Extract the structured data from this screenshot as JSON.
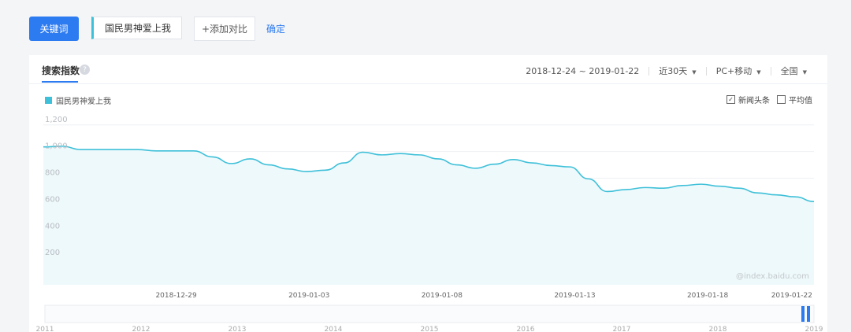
{
  "toolbar": {
    "keyword_btn": "关键词",
    "keyword_value": "国民男神爱上我",
    "add_compare": "+添加对比",
    "confirm": "确定"
  },
  "panel": {
    "tab": "搜索指数",
    "help_icon": "?",
    "date_range": "2018-12-24 ~ 2019-01-22",
    "period": "近30天",
    "device": "PC+移动",
    "region": "全国"
  },
  "options": {
    "news_label": "新闻头条",
    "news_checked": true,
    "avg_label": "平均值",
    "avg_checked": false
  },
  "watermark": "@index.baidu.com",
  "colors": {
    "accent": "#2d7bf0",
    "series": "#3ec0d8"
  },
  "chart_data": {
    "type": "area",
    "series": [
      {
        "name": "国民男神爱上我",
        "values": [
          1035,
          1040,
          1015,
          1015,
          1015,
          1015,
          1005,
          1005,
          1005,
          960,
          910,
          945,
          900,
          870,
          850,
          860,
          915,
          995,
          975,
          985,
          975,
          945,
          900,
          875,
          905,
          940,
          915,
          895,
          885,
          795,
          700,
          715,
          730,
          725,
          745,
          755,
          740,
          725,
          690,
          675,
          660,
          625
        ]
      }
    ],
    "x_ticks": [
      "2018-12-29",
      "2019-01-03",
      "2019-01-08",
      "2019-01-13",
      "2019-01-18",
      "2019-01-22"
    ],
    "y_ticks": [
      "1,200",
      "1,000",
      "800",
      "600",
      "400",
      "200"
    ],
    "ylim": [
      0,
      1240
    ],
    "grid": true,
    "legend": "top-left",
    "overview_years": [
      "2011",
      "2012",
      "2013",
      "2014",
      "2015",
      "2016",
      "2017",
      "2018",
      "2019"
    ]
  }
}
